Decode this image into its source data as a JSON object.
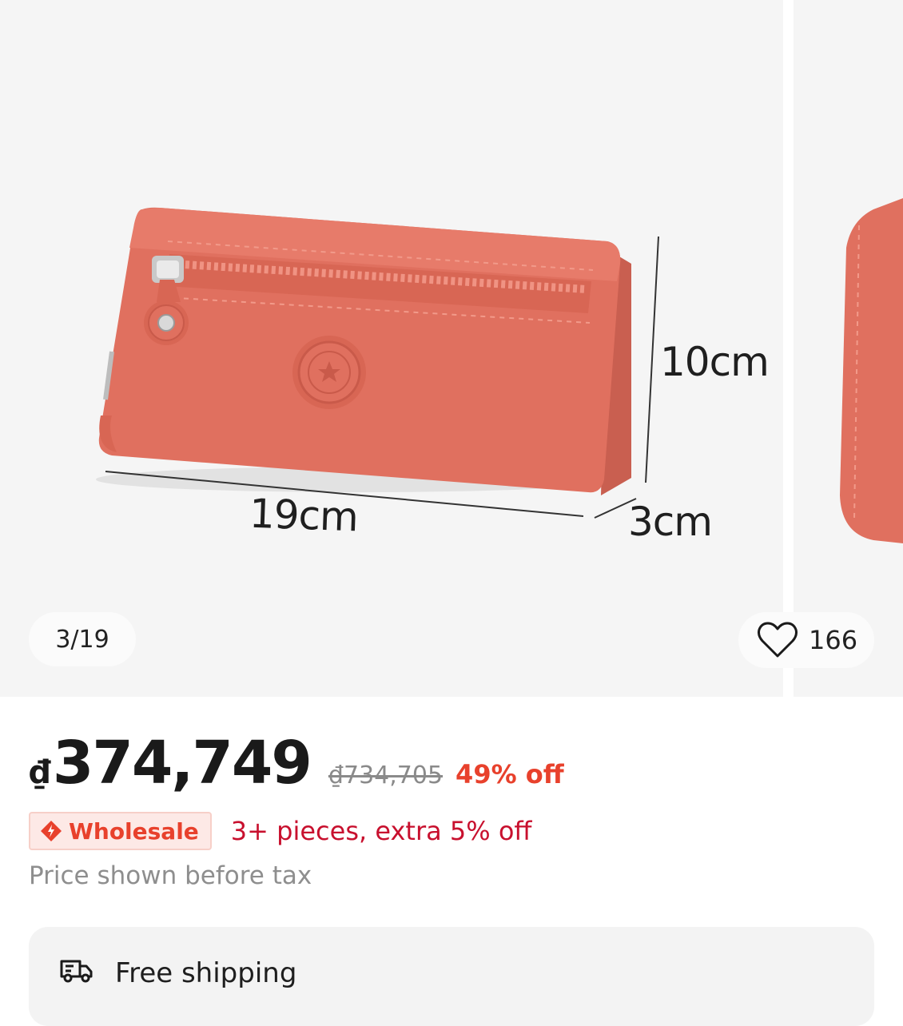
{
  "gallery": {
    "counter": "3/19",
    "favorites_count": "166",
    "dimensions": {
      "height": "10cm",
      "width": "19cm",
      "depth": "3cm"
    },
    "colors": {
      "product": "#e0705f",
      "background": "#f5f5f5"
    }
  },
  "price": {
    "currency_symbol": "₫",
    "current": "374,749",
    "original": "₫734,705",
    "discount": "49% off"
  },
  "wholesale": {
    "badge_label": "Wholesale",
    "description": "3+ pieces, extra 5% off"
  },
  "tax_note": "Price shown before tax",
  "shipping": {
    "label": "Free shipping",
    "icon": "truck-icon"
  },
  "theme": {
    "accent": "#e8412c",
    "promo_text": "#c8102e"
  }
}
